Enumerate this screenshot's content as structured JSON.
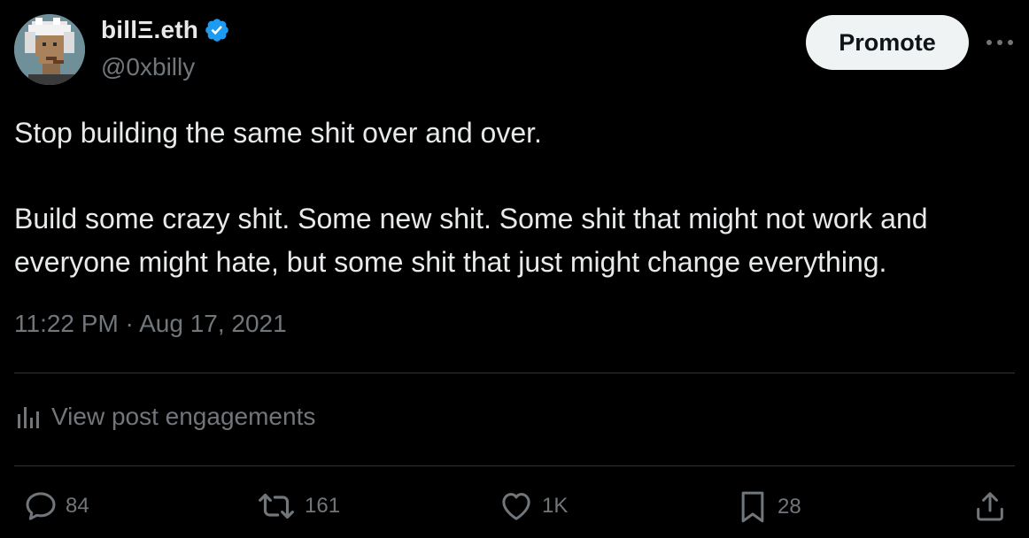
{
  "author": {
    "display_name": "billΞ.eth",
    "handle": "@0xbilly",
    "verified_icon": "verified-badge-icon",
    "avatar_icon": "pixel-punk-avatar"
  },
  "header": {
    "promote_label": "Promote",
    "more_icon": "more-horizontal-icon"
  },
  "tweet": {
    "paragraphs": [
      "Stop building the same shit over and over.",
      "Build some crazy shit. Some new shit. Some shit that might not work and everyone might hate, but some shit that just might change everything."
    ],
    "timestamp": "11:22 PM · Aug 17, 2021"
  },
  "engagements": {
    "label": "View post engagements",
    "icon": "analytics-bar-icon"
  },
  "actions": {
    "reply": {
      "icon": "reply-icon",
      "count": "84"
    },
    "repost": {
      "icon": "repost-icon",
      "count": "161"
    },
    "like": {
      "icon": "heart-icon",
      "count": "1K"
    },
    "bookmark": {
      "icon": "bookmark-icon",
      "count": "28"
    },
    "share": {
      "icon": "share-icon"
    }
  },
  "colors": {
    "background": "#000000",
    "text_primary": "#e7e9ea",
    "text_secondary": "#71767b",
    "divider": "#2f3336",
    "verified_blue": "#1d9bf0",
    "button_bg": "#eff3f4"
  }
}
